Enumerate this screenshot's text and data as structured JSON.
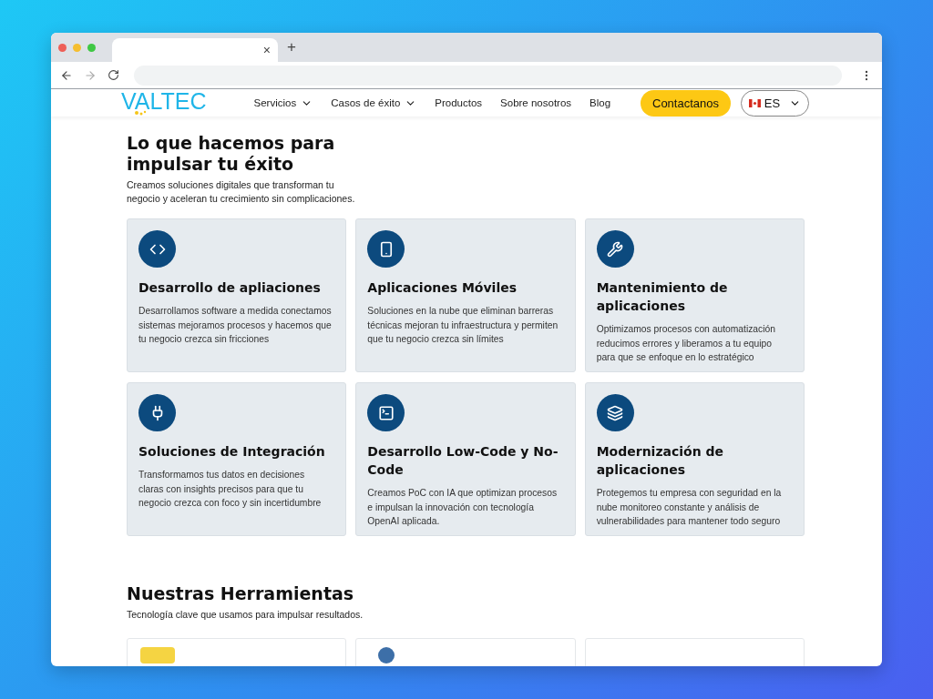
{
  "browser": {
    "tab_close": "×",
    "new_tab": "+"
  },
  "header": {
    "logo": "VALTEC",
    "nav": [
      {
        "label": "Servicios",
        "has_menu": true
      },
      {
        "label": "Casos de éxito",
        "has_menu": true
      },
      {
        "label": "Productos",
        "has_menu": false
      },
      {
        "label": "Sobre nosotros",
        "has_menu": false
      },
      {
        "label": "Blog",
        "has_menu": false
      }
    ],
    "cta": "Contactanos",
    "language": "ES"
  },
  "services": {
    "title": "Lo que hacemos para impulsar tu éxito",
    "subtitle": "Creamos soluciones digitales que transforman tu negocio y aceleran tu crecimiento sin complicaciones.",
    "cards": [
      {
        "title": "Desarrollo de apliaciones",
        "text": "Desarrollamos software a medida conectamos sistemas mejoramos procesos y hacemos que tu negocio crezca sin fricciones"
      },
      {
        "title": "Aplicaciones Móviles",
        "text": "Soluciones en la nube que eliminan barreras técnicas mejoran tu infraestructura y permiten que tu negocio crezca sin límites"
      },
      {
        "title": "Mantenimiento de aplicaciones",
        "text": "Optimizamos procesos con automatización reducimos errores y liberamos a tu equipo para que se enfoque en lo estratégico"
      },
      {
        "title": "Soluciones de Integración",
        "text": "Transformamos tus datos en decisiones claras con insights precisos para que tu negocio crezca con foco y sin incertidumbre"
      },
      {
        "title": "Desarrollo Low-Code y No-Code",
        "text": "Creamos PoC con IA que optimizan procesos e impulsan la innovación con tecnología OpenAI aplicada."
      },
      {
        "title": "Modernización de aplicaciones",
        "text": "Protegemos tu empresa con seguridad en la nube monitoreo constante y análisis de vulnerabilidades para mantener todo seguro"
      }
    ]
  },
  "tools": {
    "title": "Nuestras Herramientas",
    "subtitle": "Tecnología clave que usamos para impulsar resultados.",
    "cards": [
      {
        "kind": "bar",
        "color": "#f5d442"
      },
      {
        "kind": "circle",
        "color": "#3d6fa8"
      },
      {
        "kind": "blank"
      }
    ]
  }
}
